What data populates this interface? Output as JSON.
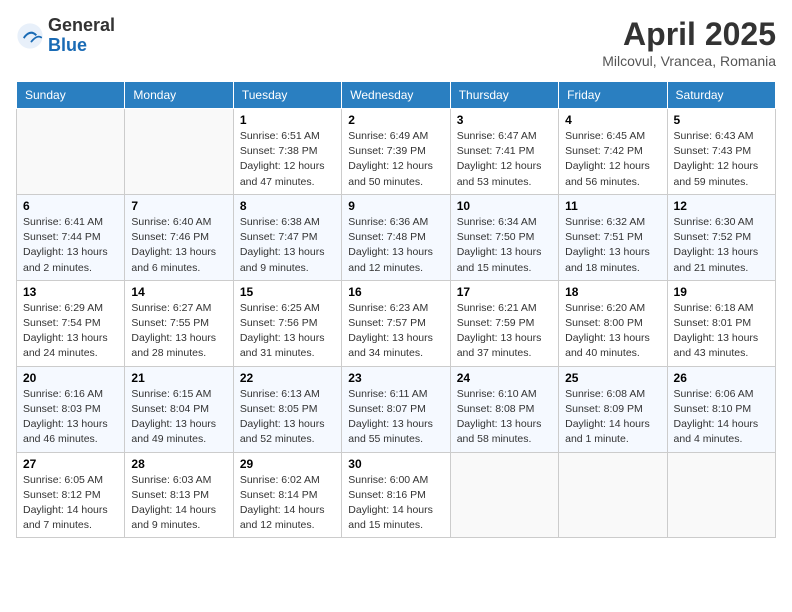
{
  "header": {
    "logo_general": "General",
    "logo_blue": "Blue",
    "month_title": "April 2025",
    "location": "Milcovul, Vrancea, Romania"
  },
  "days_of_week": [
    "Sunday",
    "Monday",
    "Tuesday",
    "Wednesday",
    "Thursday",
    "Friday",
    "Saturday"
  ],
  "weeks": [
    [
      {
        "day": "",
        "sunrise": "",
        "sunset": "",
        "daylight": ""
      },
      {
        "day": "",
        "sunrise": "",
        "sunset": "",
        "daylight": ""
      },
      {
        "day": "1",
        "sunrise": "Sunrise: 6:51 AM",
        "sunset": "Sunset: 7:38 PM",
        "daylight": "Daylight: 12 hours and 47 minutes."
      },
      {
        "day": "2",
        "sunrise": "Sunrise: 6:49 AM",
        "sunset": "Sunset: 7:39 PM",
        "daylight": "Daylight: 12 hours and 50 minutes."
      },
      {
        "day": "3",
        "sunrise": "Sunrise: 6:47 AM",
        "sunset": "Sunset: 7:41 PM",
        "daylight": "Daylight: 12 hours and 53 minutes."
      },
      {
        "day": "4",
        "sunrise": "Sunrise: 6:45 AM",
        "sunset": "Sunset: 7:42 PM",
        "daylight": "Daylight: 12 hours and 56 minutes."
      },
      {
        "day": "5",
        "sunrise": "Sunrise: 6:43 AM",
        "sunset": "Sunset: 7:43 PM",
        "daylight": "Daylight: 12 hours and 59 minutes."
      }
    ],
    [
      {
        "day": "6",
        "sunrise": "Sunrise: 6:41 AM",
        "sunset": "Sunset: 7:44 PM",
        "daylight": "Daylight: 13 hours and 2 minutes."
      },
      {
        "day": "7",
        "sunrise": "Sunrise: 6:40 AM",
        "sunset": "Sunset: 7:46 PM",
        "daylight": "Daylight: 13 hours and 6 minutes."
      },
      {
        "day": "8",
        "sunrise": "Sunrise: 6:38 AM",
        "sunset": "Sunset: 7:47 PM",
        "daylight": "Daylight: 13 hours and 9 minutes."
      },
      {
        "day": "9",
        "sunrise": "Sunrise: 6:36 AM",
        "sunset": "Sunset: 7:48 PM",
        "daylight": "Daylight: 13 hours and 12 minutes."
      },
      {
        "day": "10",
        "sunrise": "Sunrise: 6:34 AM",
        "sunset": "Sunset: 7:50 PM",
        "daylight": "Daylight: 13 hours and 15 minutes."
      },
      {
        "day": "11",
        "sunrise": "Sunrise: 6:32 AM",
        "sunset": "Sunset: 7:51 PM",
        "daylight": "Daylight: 13 hours and 18 minutes."
      },
      {
        "day": "12",
        "sunrise": "Sunrise: 6:30 AM",
        "sunset": "Sunset: 7:52 PM",
        "daylight": "Daylight: 13 hours and 21 minutes."
      }
    ],
    [
      {
        "day": "13",
        "sunrise": "Sunrise: 6:29 AM",
        "sunset": "Sunset: 7:54 PM",
        "daylight": "Daylight: 13 hours and 24 minutes."
      },
      {
        "day": "14",
        "sunrise": "Sunrise: 6:27 AM",
        "sunset": "Sunset: 7:55 PM",
        "daylight": "Daylight: 13 hours and 28 minutes."
      },
      {
        "day": "15",
        "sunrise": "Sunrise: 6:25 AM",
        "sunset": "Sunset: 7:56 PM",
        "daylight": "Daylight: 13 hours and 31 minutes."
      },
      {
        "day": "16",
        "sunrise": "Sunrise: 6:23 AM",
        "sunset": "Sunset: 7:57 PM",
        "daylight": "Daylight: 13 hours and 34 minutes."
      },
      {
        "day": "17",
        "sunrise": "Sunrise: 6:21 AM",
        "sunset": "Sunset: 7:59 PM",
        "daylight": "Daylight: 13 hours and 37 minutes."
      },
      {
        "day": "18",
        "sunrise": "Sunrise: 6:20 AM",
        "sunset": "Sunset: 8:00 PM",
        "daylight": "Daylight: 13 hours and 40 minutes."
      },
      {
        "day": "19",
        "sunrise": "Sunrise: 6:18 AM",
        "sunset": "Sunset: 8:01 PM",
        "daylight": "Daylight: 13 hours and 43 minutes."
      }
    ],
    [
      {
        "day": "20",
        "sunrise": "Sunrise: 6:16 AM",
        "sunset": "Sunset: 8:03 PM",
        "daylight": "Daylight: 13 hours and 46 minutes."
      },
      {
        "day": "21",
        "sunrise": "Sunrise: 6:15 AM",
        "sunset": "Sunset: 8:04 PM",
        "daylight": "Daylight: 13 hours and 49 minutes."
      },
      {
        "day": "22",
        "sunrise": "Sunrise: 6:13 AM",
        "sunset": "Sunset: 8:05 PM",
        "daylight": "Daylight: 13 hours and 52 minutes."
      },
      {
        "day": "23",
        "sunrise": "Sunrise: 6:11 AM",
        "sunset": "Sunset: 8:07 PM",
        "daylight": "Daylight: 13 hours and 55 minutes."
      },
      {
        "day": "24",
        "sunrise": "Sunrise: 6:10 AM",
        "sunset": "Sunset: 8:08 PM",
        "daylight": "Daylight: 13 hours and 58 minutes."
      },
      {
        "day": "25",
        "sunrise": "Sunrise: 6:08 AM",
        "sunset": "Sunset: 8:09 PM",
        "daylight": "Daylight: 14 hours and 1 minute."
      },
      {
        "day": "26",
        "sunrise": "Sunrise: 6:06 AM",
        "sunset": "Sunset: 8:10 PM",
        "daylight": "Daylight: 14 hours and 4 minutes."
      }
    ],
    [
      {
        "day": "27",
        "sunrise": "Sunrise: 6:05 AM",
        "sunset": "Sunset: 8:12 PM",
        "daylight": "Daylight: 14 hours and 7 minutes."
      },
      {
        "day": "28",
        "sunrise": "Sunrise: 6:03 AM",
        "sunset": "Sunset: 8:13 PM",
        "daylight": "Daylight: 14 hours and 9 minutes."
      },
      {
        "day": "29",
        "sunrise": "Sunrise: 6:02 AM",
        "sunset": "Sunset: 8:14 PM",
        "daylight": "Daylight: 14 hours and 12 minutes."
      },
      {
        "day": "30",
        "sunrise": "Sunrise: 6:00 AM",
        "sunset": "Sunset: 8:16 PM",
        "daylight": "Daylight: 14 hours and 15 minutes."
      },
      {
        "day": "",
        "sunrise": "",
        "sunset": "",
        "daylight": ""
      },
      {
        "day": "",
        "sunrise": "",
        "sunset": "",
        "daylight": ""
      },
      {
        "day": "",
        "sunrise": "",
        "sunset": "",
        "daylight": ""
      }
    ]
  ]
}
